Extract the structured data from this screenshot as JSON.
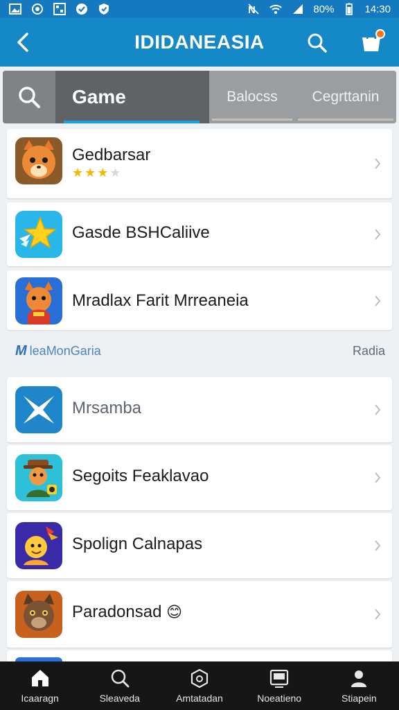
{
  "status_bar": {
    "left_icons": [
      "image-icon",
      "circle-icon",
      "grid-icon",
      "check-shield-icon",
      "shield-icon"
    ],
    "right_icons": [
      "nfc-icon",
      "wifi-icon",
      "signal-icon"
    ],
    "battery": "80%",
    "time": "14:30"
  },
  "app_bar": {
    "title": "IDIDANEASIA",
    "back_icon": "chevron-left-icon",
    "search_icon": "search-icon",
    "cart_icon": "cart-icon"
  },
  "tabs": {
    "search_icon": "search-icon",
    "items": [
      {
        "label": "Game",
        "active": true
      },
      {
        "label": "Balocss",
        "active": false
      },
      {
        "label": "Cegrttanin",
        "active": false
      }
    ]
  },
  "list_top": [
    {
      "name": "Gedbarsar",
      "icon": "fox-game-icon",
      "rating": 3,
      "rating_max": 4
    },
    {
      "name": "Gasde BSHCaliive",
      "icon": "star-game-icon"
    },
    {
      "name": "Mradlax Farit Mrreaneia",
      "icon": "fox-hero-icon"
    }
  ],
  "section": {
    "left_label": "leaMonGaria",
    "right_label": "Radia"
  },
  "list_bottom": [
    {
      "name": "Mrsamba",
      "icon": "plane-game-icon",
      "muted": true
    },
    {
      "name": "Segoits Feaklavao",
      "icon": "explorer-game-icon"
    },
    {
      "name": "Spolign Calnapas",
      "icon": "hero-game-icon"
    },
    {
      "name": "Paradonsad",
      "icon": "cat-game-icon",
      "emoji": "😊"
    }
  ],
  "bottom_nav": [
    {
      "label": "Icaaragn",
      "icon": "home-icon"
    },
    {
      "label": "Sleaveda",
      "icon": "search-icon"
    },
    {
      "label": "Amtatadan",
      "icon": "bag-icon"
    },
    {
      "label": "Noeatieno",
      "icon": "inbox-icon"
    },
    {
      "label": "Stiapein",
      "icon": "profile-icon"
    }
  ],
  "colors": {
    "app_bar": "#1589c8",
    "status_bar": "#1479be",
    "tab_accent": "#1aa3e0",
    "star": "#f5b800",
    "nav_bg": "#161616"
  }
}
